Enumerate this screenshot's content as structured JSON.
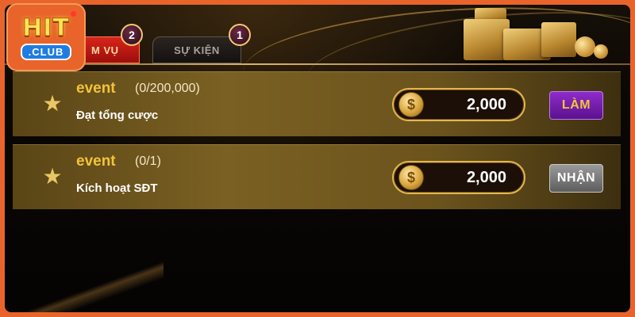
{
  "logo": {
    "brand": "HIT",
    "suffix": ".CLUB"
  },
  "tabs": [
    {
      "label": "M VỤ",
      "badge": "2",
      "active": true
    },
    {
      "label": "SỰ KIỆN",
      "badge": "1",
      "active": false
    }
  ],
  "events": [
    {
      "name": "event",
      "progress": "(0/200,000)",
      "description": "Đạt tổng cược",
      "reward": "2,000",
      "coin_symbol": "$",
      "button": "LÀM",
      "button_state": "active"
    },
    {
      "name": "event",
      "progress": "(0/1)",
      "description": "Kích hoạt SĐT",
      "reward": "2,000",
      "coin_symbol": "$",
      "button": "NHẬN",
      "button_state": "disabled"
    }
  ],
  "colors": {
    "accent_gold": "#f2c43a",
    "frame_orange": "#e8642b",
    "button_purple": "#7a1fb0",
    "button_gray": "#7a7a7a"
  }
}
